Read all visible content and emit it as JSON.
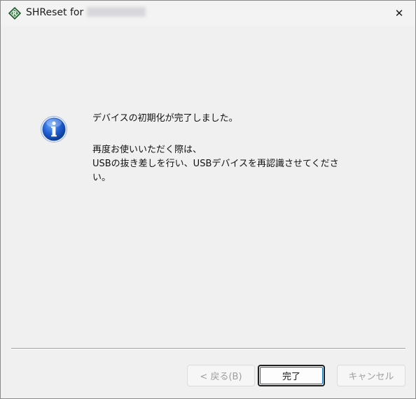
{
  "window": {
    "title": "SHReset for",
    "title_hidden_suffix": "",
    "close_glyph": "✕"
  },
  "icons": {
    "app": "app-logo-icon",
    "info": "info-icon",
    "close": "close-icon"
  },
  "message": {
    "line1": "デバイスの初期化が完了しました。",
    "line2": "再度お使いいただく際は、",
    "line3": "USBの抜き差しを行い、USBデバイスを再認識させてくださ",
    "line4": "い。"
  },
  "buttons": {
    "back_label": "< 戻る(B)",
    "finish_label": "完了",
    "cancel_label": "キャンセル"
  },
  "colors": {
    "background": "#f0f0f0",
    "info_blue": "#1c5cc0",
    "focus_blue": "#0067c0"
  }
}
